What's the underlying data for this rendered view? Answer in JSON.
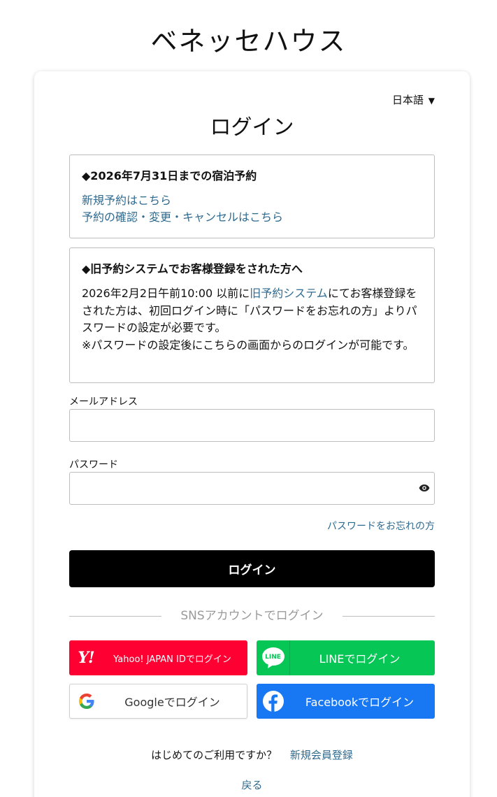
{
  "site": {
    "title": "ベネッセハウス"
  },
  "language": {
    "selected": "日本語",
    "caret": "▼"
  },
  "login": {
    "title": "ログイン"
  },
  "notice1": {
    "heading": "◆2026年7月31日までの宿泊予約",
    "links": [
      "新規予約はこちら",
      "予約の確認・変更・キャンセルはこちら"
    ]
  },
  "notice2": {
    "heading": "◆旧予約システムでお客様登録をされた方へ",
    "body_before_link": "2026年2月2日午前10:00 以前に",
    "link": "旧予約システム",
    "body_after_link": "にてお客様登録をされた方は、初回ログイン時に「パスワードをお忘れの方」よりパスワードの設定が必要です。",
    "note": "※パスワードの設定後にこちらの画面からのログインが可能です。"
  },
  "form": {
    "email_label": "メールアドレス",
    "email_value": "",
    "password_label": "パスワード",
    "password_value": "",
    "forgot_link": "パスワードをお忘れの方",
    "submit_label": "ログイン"
  },
  "sns": {
    "divider": "SNSアカウントでログイン",
    "yahoo": "Yahoo! JAPAN IDでログイン",
    "line": "LINEでログイン",
    "google": "Googleでログイン",
    "facebook": "Facebookでログイン",
    "yahoo_logo": "Y!",
    "line_logo": "LINE",
    "google_logo": "G",
    "facebook_logo": "f"
  },
  "footer": {
    "first_time": "はじめてのご利用ですか？",
    "signup": "新規会員登録",
    "back": "戻る"
  },
  "colors": {
    "link": "#2f6a8f",
    "yahoo": "#ff0033",
    "line": "#06c755",
    "facebook": "#1877f2",
    "primary_button": "#000000"
  }
}
